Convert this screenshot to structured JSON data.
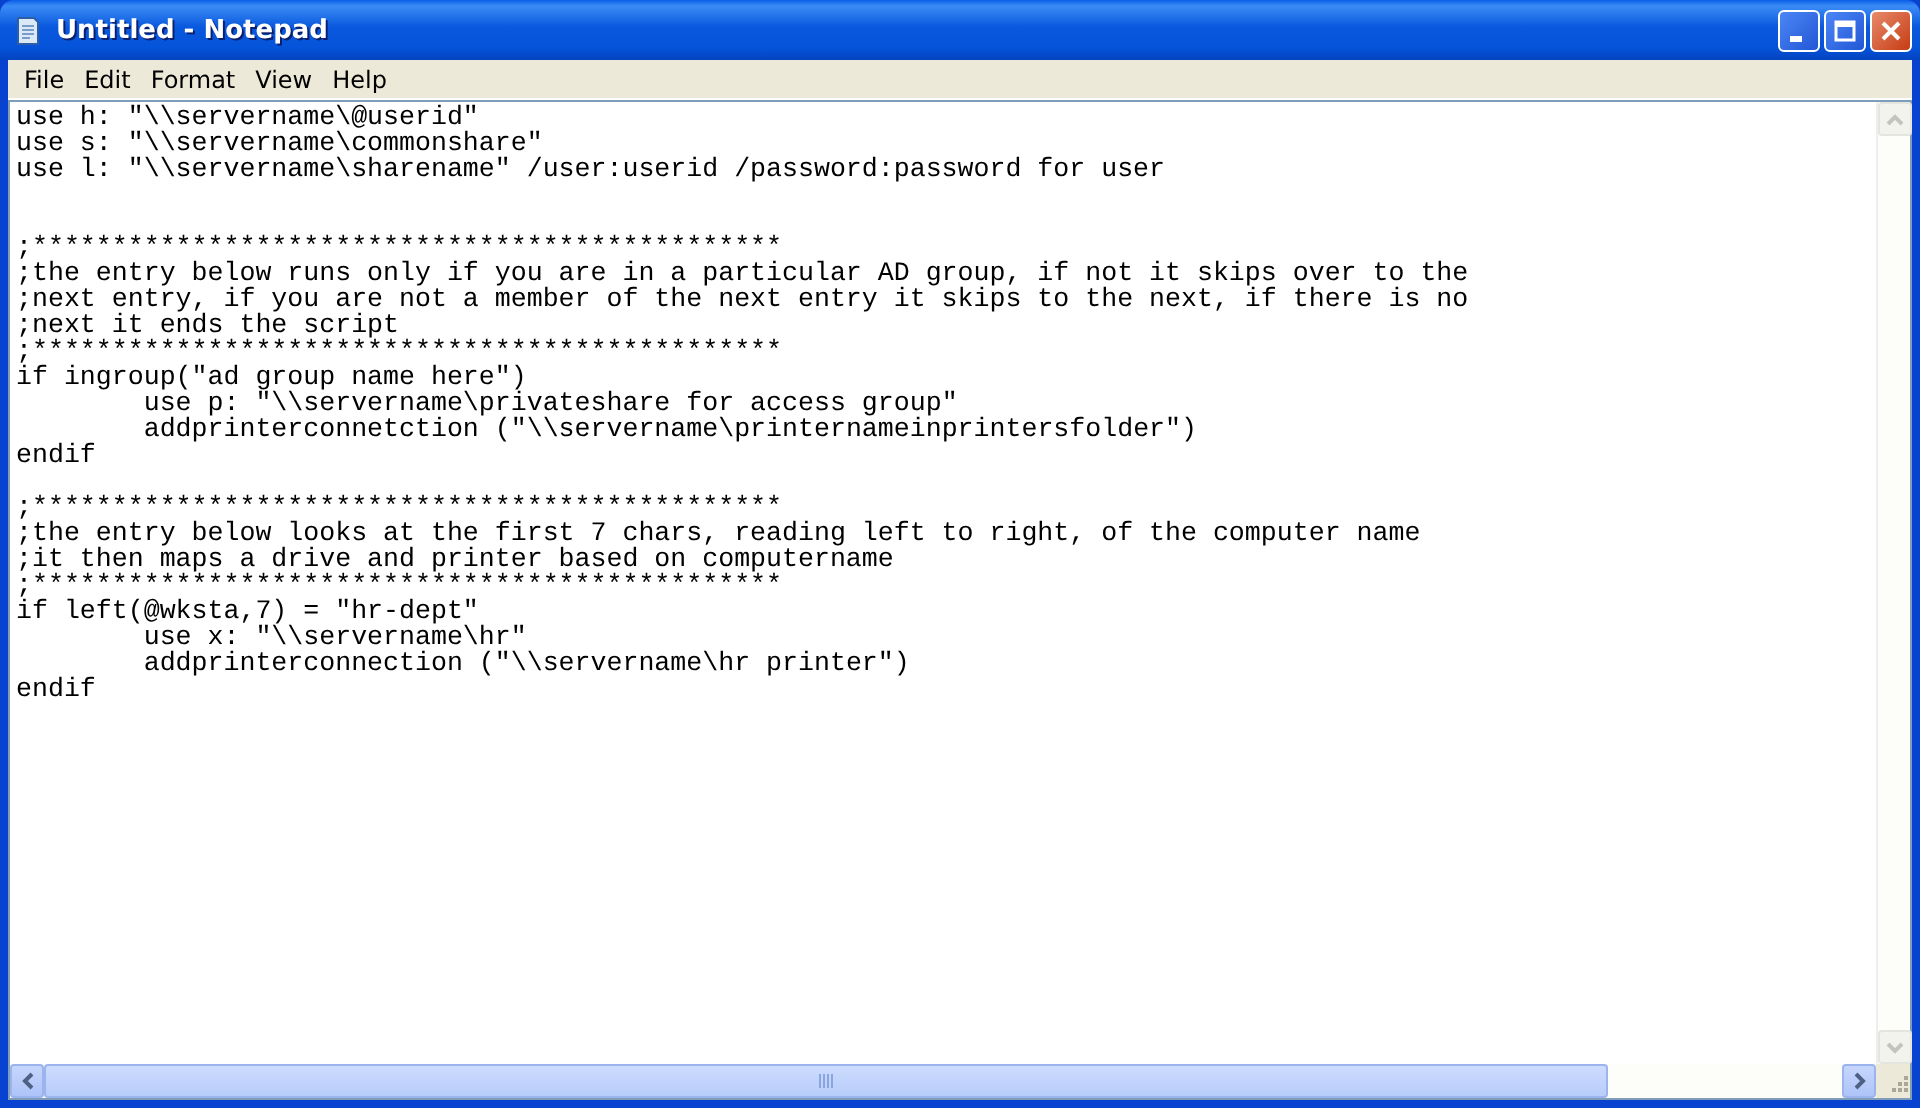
{
  "window": {
    "title": "Untitled - Notepad"
  },
  "menu": [
    {
      "label": "File"
    },
    {
      "label": "Edit"
    },
    {
      "label": "Format"
    },
    {
      "label": "View"
    },
    {
      "label": "Help"
    }
  ],
  "editor": {
    "text": "use h: \"\\\\servername\\@userid\"\nuse s: \"\\\\servername\\commonshare\"\nuse l: \"\\\\servername\\sharename\" /user:userid /password:password for user\n\n\n;***********************************************\n;the entry below runs only if you are in a particular AD group, if not it skips over to the\n;next entry, if you are not a member of the next entry it skips to the next, if there is no\n;next it ends the script\n;***********************************************\nif ingroup(\"ad group name here\")\n\tuse p: \"\\\\servername\\privateshare for access group\"\n\taddprinterconnetction (\"\\\\servername\\printernameinprintersfolder\")\nendif\n\n;***********************************************\n;the entry below looks at the first 7 chars, reading left to right, of the computer name\n;it then maps a drive and printer based on computername\n;***********************************************\nif left(@wksta,7) = \"hr-dept\"\n\tuse x: \"\\\\servername\\hr\"\n\taddprinterconnection (\"\\\\servername\\hr printer\")\nendif"
  }
}
